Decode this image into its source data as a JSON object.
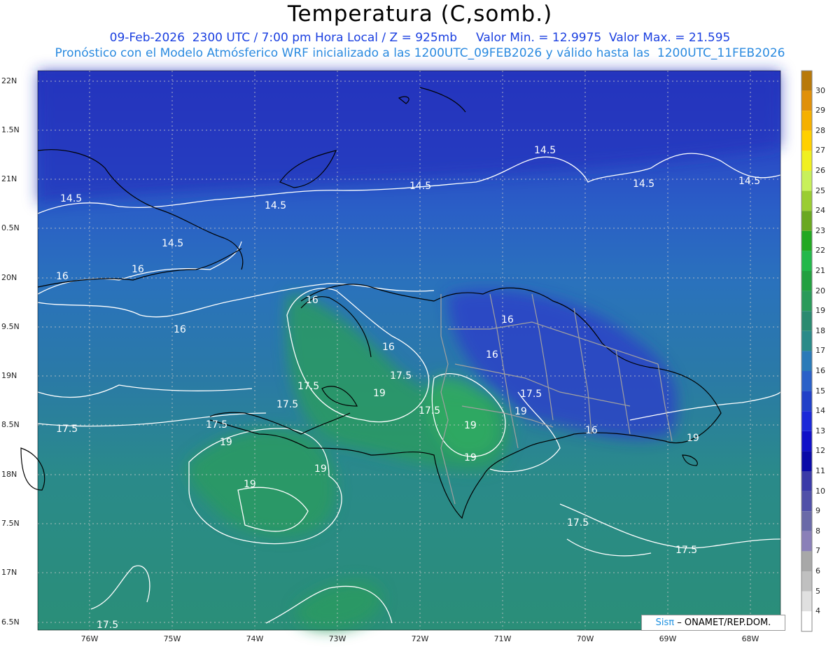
{
  "title": "Temperatura (C,somb.)",
  "subtitle_line1": "09-Feb-2026  2300 UTC / 7:00 pm Hora Local / Z = 925mb     Valor Min. = 12.9975  Valor Max. = 21.595",
  "subtitle_line2": "Pronóstico con el Modelo Atmósferico WRF inicializado a las 1200UTC_09FEB2026 y válido hasta las  1200UTC_11FEB2026",
  "lat_labels": [
    "22N",
    "1.5N",
    "21N",
    "0.5N",
    "20N",
    "9.5N",
    "19N",
    "8.5N",
    "18N",
    "7.5N",
    "17N",
    "6.5N"
  ],
  "lon_labels": [
    "76W",
    "75W",
    "74W",
    "73W",
    "72W",
    "71W",
    "70W",
    "69W",
    "68W"
  ],
  "colorbar": {
    "levels": [
      "30",
      "29",
      "28",
      "27",
      "26",
      "25",
      "24",
      "23",
      "22",
      "21",
      "20",
      "19",
      "18",
      "17",
      "16",
      "15",
      "14",
      "13",
      "12",
      "11",
      "10",
      "9",
      "8",
      "7",
      "6",
      "5",
      "4"
    ],
    "colors": [
      "#b8790a",
      "#e0900a",
      "#f5b000",
      "#ffd000",
      "#f0f020",
      "#c8f05a",
      "#9acd32",
      "#6aa820",
      "#22a822",
      "#22b84a",
      "#22a040",
      "#2a9a5a",
      "#2a8a70",
      "#2a8a88",
      "#2a7ab8",
      "#2a60c8",
      "#2040c8",
      "#1a28d8",
      "#1010c8",
      "#0a0aa8",
      "#3a3aa8",
      "#5050a8",
      "#6a6aa8",
      "#8a80b8",
      "#a8a8a8",
      "#c0c0c0",
      "#e0e0e0",
      "#ffffff"
    ]
  },
  "contour_labels": [
    "14.5",
    "14.5",
    "14.5",
    "14.5",
    "14.5",
    "14.5",
    "14.5",
    "16",
    "16",
    "16",
    "16",
    "16",
    "16",
    "16",
    "16",
    "17.5",
    "17.5",
    "17.5",
    "17.5",
    "17.5",
    "17.5",
    "17.5",
    "17.5",
    "17.5",
    "17.5",
    "19",
    "19",
    "19",
    "19",
    "19",
    "19",
    "19",
    "19"
  ],
  "credit": {
    "brand": "Sisπ",
    "text": "– ONAMET/REP.DOM."
  }
}
